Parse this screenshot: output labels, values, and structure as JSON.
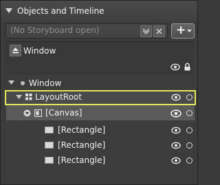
{
  "panel": {
    "title": "Objects and Timeline"
  },
  "storyboard": {
    "picker_text": "(No Storyboard open)",
    "new_button_label": "+"
  },
  "scope": {
    "label": "Window"
  },
  "tree": [
    {
      "label": "Window",
      "level": 0
    },
    {
      "label": "LayoutRoot",
      "level": 1,
      "selected": true
    },
    {
      "label": "[Canvas]",
      "level": 2
    },
    {
      "label": "[Rectangle]",
      "level": 3
    },
    {
      "label": "[Rectangle]",
      "level": 3
    },
    {
      "label": "[Rectangle]",
      "level": 3
    }
  ],
  "colors": {
    "background": "#3c3c3c",
    "selection_border": "#e3e85a",
    "canvas_row": "#5a5a5a",
    "text": "#f0f0f0"
  },
  "icons": [
    "collapse-triangle-icon",
    "storyboard-options-icon",
    "close-storyboard-icon",
    "dropdown-arrow-icon",
    "scope-up-icon",
    "eye-icon",
    "lock-icon",
    "grid-icon",
    "canvas-icon",
    "rectangle-icon"
  ]
}
